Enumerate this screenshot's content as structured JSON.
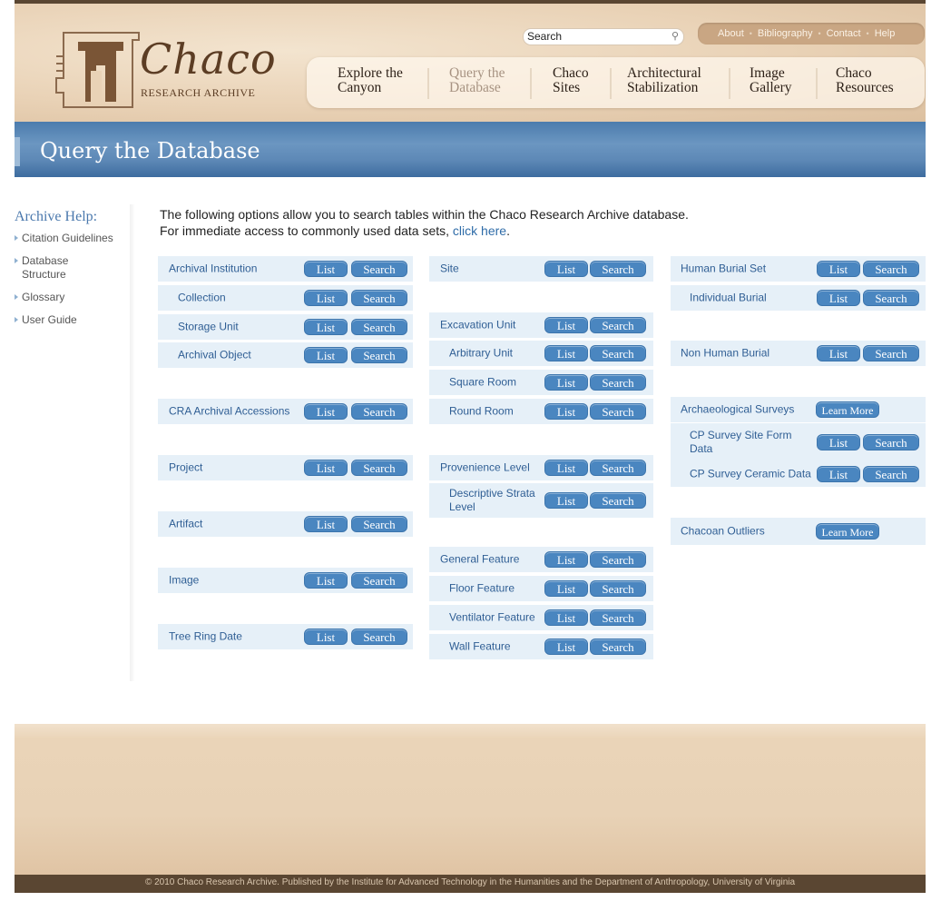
{
  "logo": {
    "title": "Chaco",
    "subtitle": "RESEARCH ARCHIVE"
  },
  "search": {
    "placeholder": "Search"
  },
  "utility_links": [
    "About",
    "Bibliography",
    "Contact",
    "Help"
  ],
  "nav": [
    {
      "line1": "Explore the",
      "line2": "Canyon",
      "active": false
    },
    {
      "line1": "Query the",
      "line2": "Database",
      "active": true
    },
    {
      "line1": "Chaco",
      "line2": "Sites",
      "active": false
    },
    {
      "line1": "Architectural",
      "line2": "Stabilization",
      "active": false
    },
    {
      "line1": "Image",
      "line2": "Gallery",
      "active": false
    },
    {
      "line1": "Chaco",
      "line2": "Resources",
      "active": false
    }
  ],
  "banner": {
    "title": "Query the Database"
  },
  "sidebar": {
    "title": "Archive Help:",
    "items": [
      {
        "line1": "Citation Guidelines",
        "line2": ""
      },
      {
        "line1": "Database",
        "line2": "Structure"
      },
      {
        "line1": "Glossary",
        "line2": ""
      },
      {
        "line1": "User Guide",
        "line2": ""
      }
    ]
  },
  "intro": {
    "line1": "The following options allow you to search tables within the Chaco Research Archive database.",
    "line2_prefix": "For immediate access to commonly used data sets,",
    "link": "click here",
    "line2_suffix": "."
  },
  "buttons": {
    "list": "List",
    "search": "Search",
    "learn_more": "Learn More"
  },
  "columns": [
    {
      "rows": [
        {
          "label": "Archival Institution",
          "indent": false,
          "shaded": true,
          "kind": "list-search"
        },
        {
          "label": "Collection",
          "indent": true,
          "shaded": true,
          "kind": "list-search"
        },
        {
          "label": "Storage Unit",
          "indent": true,
          "shaded": true,
          "kind": "list-search"
        },
        {
          "label": "Archival Object",
          "indent": true,
          "shaded": true,
          "kind": "list-search"
        },
        {
          "label": "CRA Archival Accessions",
          "indent": false,
          "shaded": true,
          "kind": "list-search"
        },
        {
          "label": "Project",
          "indent": false,
          "shaded": true,
          "kind": "list-search"
        },
        {
          "label": "Artifact",
          "indent": false,
          "shaded": true,
          "kind": "list-search"
        },
        {
          "label": "Image",
          "indent": false,
          "shaded": true,
          "kind": "list-search"
        },
        {
          "label": "Tree Ring Date",
          "indent": false,
          "shaded": true,
          "kind": "list-search"
        }
      ]
    },
    {
      "rows": [
        {
          "label": "Site",
          "indent": false,
          "shaded": true,
          "kind": "list-search"
        },
        {
          "label": "Excavation Unit",
          "indent": false,
          "shaded": true,
          "kind": "list-search"
        },
        {
          "label": "Arbitrary Unit",
          "indent": true,
          "shaded": true,
          "kind": "list-search"
        },
        {
          "label": "Square Room",
          "indent": true,
          "shaded": true,
          "kind": "list-search"
        },
        {
          "label": "Round Room",
          "indent": true,
          "shaded": true,
          "kind": "list-search"
        },
        {
          "label": "Provenience Level",
          "indent": false,
          "shaded": true,
          "kind": "list-search"
        },
        {
          "label": "Descriptive Strata Level",
          "indent": true,
          "shaded": true,
          "kind": "list-search"
        },
        {
          "label": "General Feature",
          "indent": false,
          "shaded": true,
          "kind": "list-search"
        },
        {
          "label": "Floor Feature",
          "indent": true,
          "shaded": true,
          "kind": "list-search"
        },
        {
          "label": "Ventilator Feature",
          "indent": true,
          "shaded": true,
          "kind": "list-search"
        },
        {
          "label": "Wall Feature",
          "indent": true,
          "shaded": true,
          "kind": "list-search"
        }
      ]
    },
    {
      "rows": [
        {
          "label": "Human Burial Set",
          "indent": false,
          "shaded": true,
          "kind": "list-search"
        },
        {
          "label": "Individual Burial",
          "indent": true,
          "shaded": true,
          "kind": "list-search"
        },
        {
          "label": "Non Human Burial",
          "indent": false,
          "shaded": true,
          "kind": "list-search"
        },
        {
          "label": "Archaeological Surveys",
          "indent": false,
          "shaded": true,
          "kind": "learn-more"
        },
        {
          "label": "CP Survey Site Form Data",
          "indent": true,
          "shaded": true,
          "kind": "list-search"
        },
        {
          "label": "CP Survey Ceramic Data",
          "indent": true,
          "shaded": true,
          "kind": "list-search"
        },
        {
          "label": "Chacoan Outliers",
          "indent": false,
          "shaded": true,
          "kind": "learn-more"
        }
      ]
    }
  ],
  "footer": {
    "text": "© 2010 Chaco Research Archive. Published by the Institute for Advanced Technology in the Humanities and the Department of Anthropology, University of Virginia"
  },
  "colors": {
    "accent_blue": "#4a86c0",
    "banner_blue": "#4c7cad",
    "brown": "#5a4632",
    "row_shade": "#e6f0f8"
  }
}
